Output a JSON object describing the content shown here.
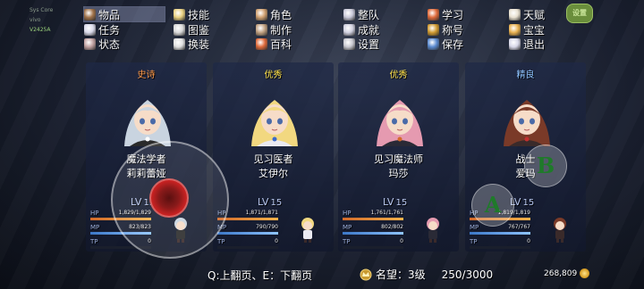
{
  "system": {
    "lines": [
      "Sys Core",
      "vivo",
      "V2425A"
    ]
  },
  "menu": {
    "items": [
      {
        "label": "物品",
        "icon": "bag-icon",
        "color": "#a0724a"
      },
      {
        "label": "技能",
        "icon": "sparkle-icon",
        "color": "#e8d080"
      },
      {
        "label": "角色",
        "icon": "person-icon",
        "color": "#d0a070"
      },
      {
        "label": "整队",
        "icon": "team-icon",
        "color": "#c8c8d8"
      },
      {
        "label": "学习",
        "icon": "book-icon",
        "color": "#e06a3a"
      },
      {
        "label": "天赋",
        "icon": "cat-icon",
        "color": "#e8e0d0"
      },
      {
        "label": "任务",
        "icon": "quest-icon",
        "color": "#d8d8e8"
      },
      {
        "label": "图鉴",
        "icon": "monster-icon",
        "color": "#d8d8d8"
      },
      {
        "label": "制作",
        "icon": "hammer-icon",
        "color": "#c0a080"
      },
      {
        "label": "成就",
        "icon": "crown-icon",
        "color": "#d0d0e0"
      },
      {
        "label": "称号",
        "icon": "medal-icon",
        "color": "#d09a30"
      },
      {
        "label": "宝宝",
        "icon": "pet-icon",
        "color": "#e8b050"
      },
      {
        "label": "状态",
        "icon": "status-icon",
        "color": "#c0a0a0"
      },
      {
        "label": "换装",
        "icon": "outfit-icon",
        "color": "#e0e0e0"
      },
      {
        "label": "百科",
        "icon": "encyclopedia-icon",
        "color": "#e06a3a"
      },
      {
        "label": "设置",
        "icon": "gear-icon",
        "color": "#c8c8d0"
      },
      {
        "label": "保存",
        "icon": "save-icon",
        "color": "#5a8ad0"
      },
      {
        "label": "退出",
        "icon": "exit-icon",
        "color": "#d8d8e8"
      }
    ],
    "settings_badge": "设置"
  },
  "party": [
    {
      "rank": "史诗",
      "rank_class": "r-epic",
      "job": "魔法学者",
      "name": "莉莉蕾娅",
      "level_label": "LV",
      "level": "15",
      "hp_label": "HP",
      "hp": "1,829/1,829",
      "hp_pct": 1.0,
      "mp_label": "MP",
      "mp": "823/823",
      "mp_pct": 1.0,
      "tp_label": "TP",
      "tp": "0",
      "tp_pct": 0,
      "hair": "#c9d4e0",
      "outfit": "#2a2a2a",
      "accent": "#ffffff"
    },
    {
      "rank": "优秀",
      "rank_class": "r-good",
      "job": "见习医者",
      "name": "艾伊尔",
      "level_label": "LV",
      "level": "15",
      "hp_label": "HP",
      "hp": "1,871/1,871",
      "hp_pct": 1.0,
      "mp_label": "MP",
      "mp": "790/790",
      "mp_pct": 1.0,
      "tp_label": "TP",
      "tp": "0",
      "tp_pct": 0,
      "hair": "#f2d880",
      "outfit": "#eaeaf2",
      "accent": "#3a6acc"
    },
    {
      "rank": "优秀",
      "rank_class": "r-good",
      "job": "见习魔法师",
      "name": "玛莎",
      "level_label": "LV",
      "level": "15",
      "hp_label": "HP",
      "hp": "1,761/1,761",
      "hp_pct": 1.0,
      "mp_label": "MP",
      "mp": "802/802",
      "mp_pct": 1.0,
      "tp_label": "TP",
      "tp": "0",
      "tp_pct": 0,
      "hair": "#e59ab0",
      "outfit": "#2a2a36",
      "accent": "#d46a2a"
    },
    {
      "rank": "精良",
      "rank_class": "r-fine",
      "job": "战士",
      "name": "爱玛",
      "level_label": "LV",
      "level": "15",
      "hp_label": "HP",
      "hp": "1,819/1,819",
      "hp_pct": 1.0,
      "mp_label": "MP",
      "mp": "767/767",
      "mp_pct": 1.0,
      "tp_label": "TP",
      "tp": "0",
      "tp_pct": 0,
      "hair": "#7a3a28",
      "outfit": "#3a2a2a",
      "accent": "#c23030"
    }
  ],
  "controls": {
    "a_label": "A",
    "b_label": "B"
  },
  "footer": {
    "pager": "Q:上翻页、E：下翻页",
    "fame_label": "名望：3级",
    "fame_progress": "250/3000",
    "gold": "268,809"
  }
}
